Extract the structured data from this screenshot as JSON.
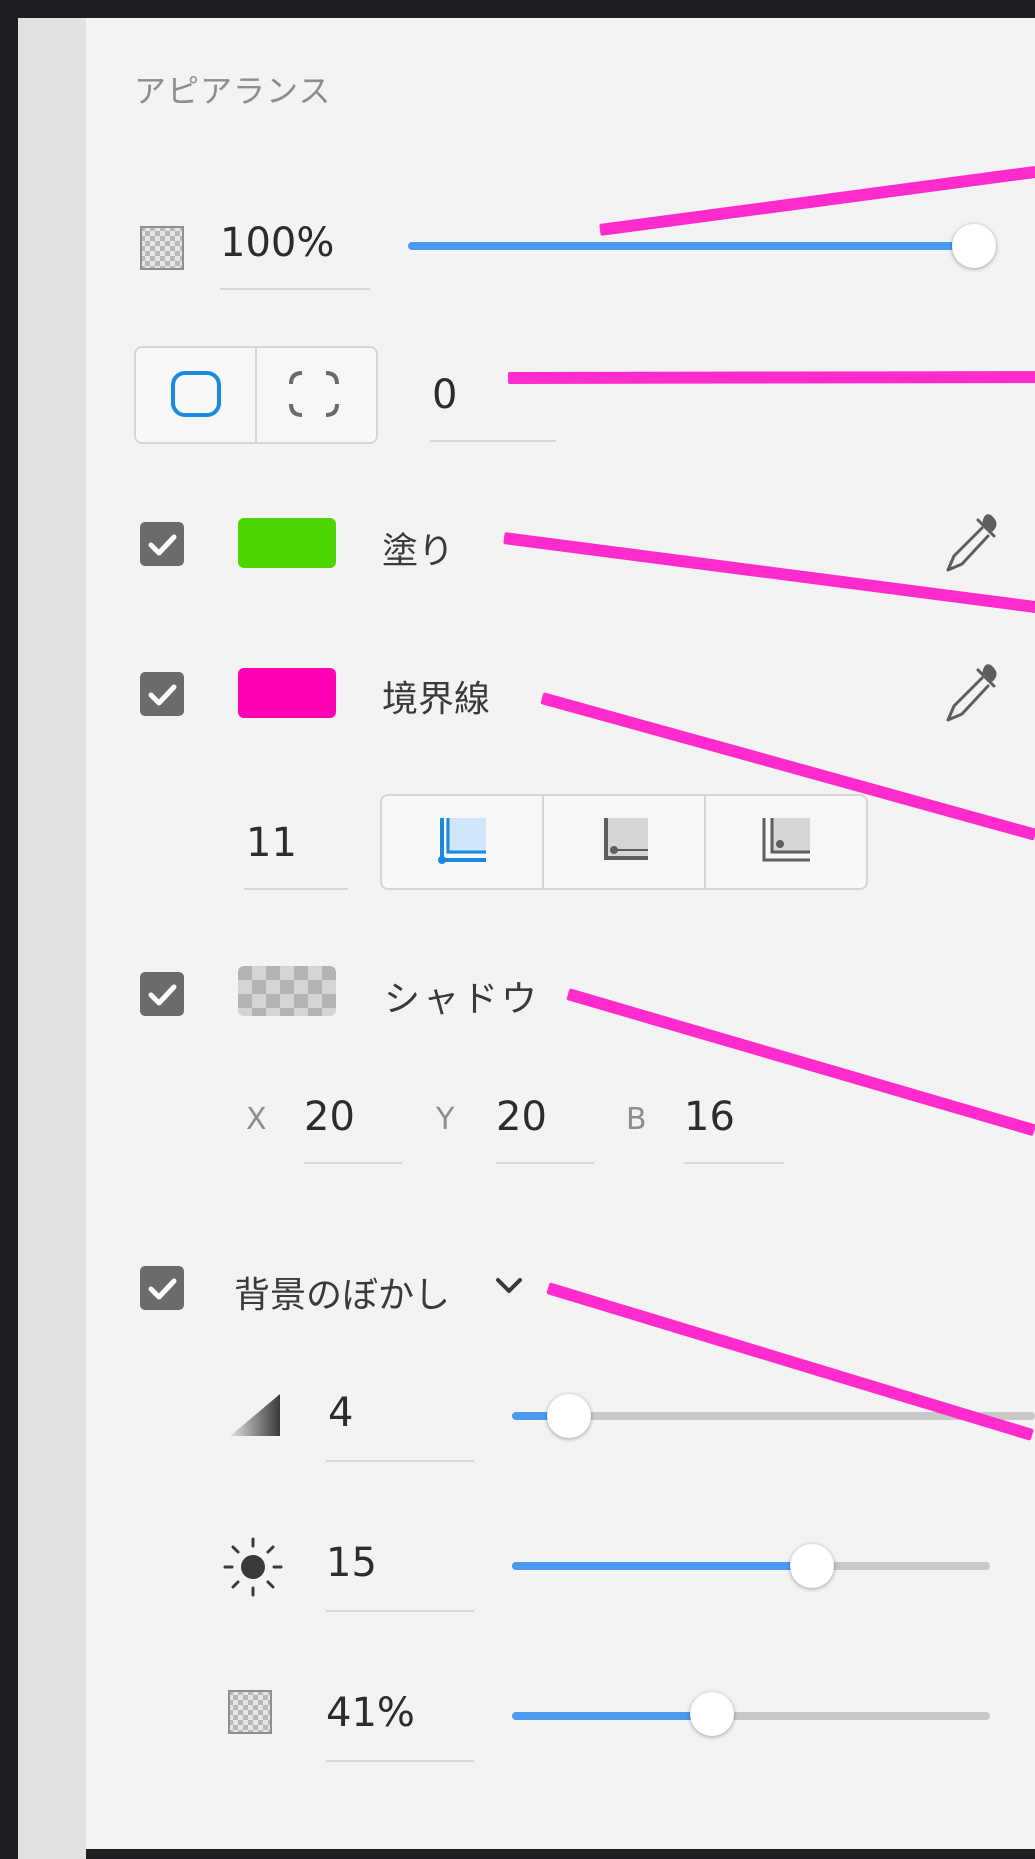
{
  "section_title": "アピアランス",
  "opacity": {
    "value": "100%",
    "slider_level": 1.0
  },
  "corner": {
    "value": "0",
    "modes": [
      "uniform-corners",
      "independent-corners"
    ],
    "selected": "uniform-corners"
  },
  "fill": {
    "label": "塗り",
    "checked": true,
    "color": "#4cd500"
  },
  "border": {
    "label": "境界線",
    "checked": true,
    "color": "#ff00b4",
    "width_value": "11",
    "alignments": [
      "inner-stroke",
      "center-stroke",
      "outer-stroke"
    ],
    "selected_alignment": "inner-stroke"
  },
  "shadow": {
    "label": "シャドウ",
    "checked": true,
    "x_label": "X",
    "x_value": "20",
    "y_label": "Y",
    "y_value": "20",
    "b_label": "B",
    "b_value": "16"
  },
  "bg_blur": {
    "label": "背景のぼかし",
    "checked": true,
    "amount_value": "4",
    "amount_slider_level": 0.12,
    "brightness_value": "15",
    "brightness_slider_level": 0.63,
    "opacity_value": "41%",
    "opacity_slider_level": 0.42
  },
  "colors": {
    "accent": "#4a9bf0",
    "selected_icon": "#1a8ae0",
    "callout": "#ff2bcc",
    "checkbox": "#6b6b6b",
    "panel_background": "#f3f3f3"
  },
  "icons": [
    "transparency-icon",
    "uniform-corners-icon",
    "independent-corners-icon",
    "checkbox-check-icon",
    "eyedropper-icon",
    "inner-stroke-icon",
    "center-stroke-icon",
    "outer-stroke-icon",
    "shadow-swatch-icon",
    "chevron-down-icon",
    "blur-amount-icon",
    "brightness-icon"
  ]
}
